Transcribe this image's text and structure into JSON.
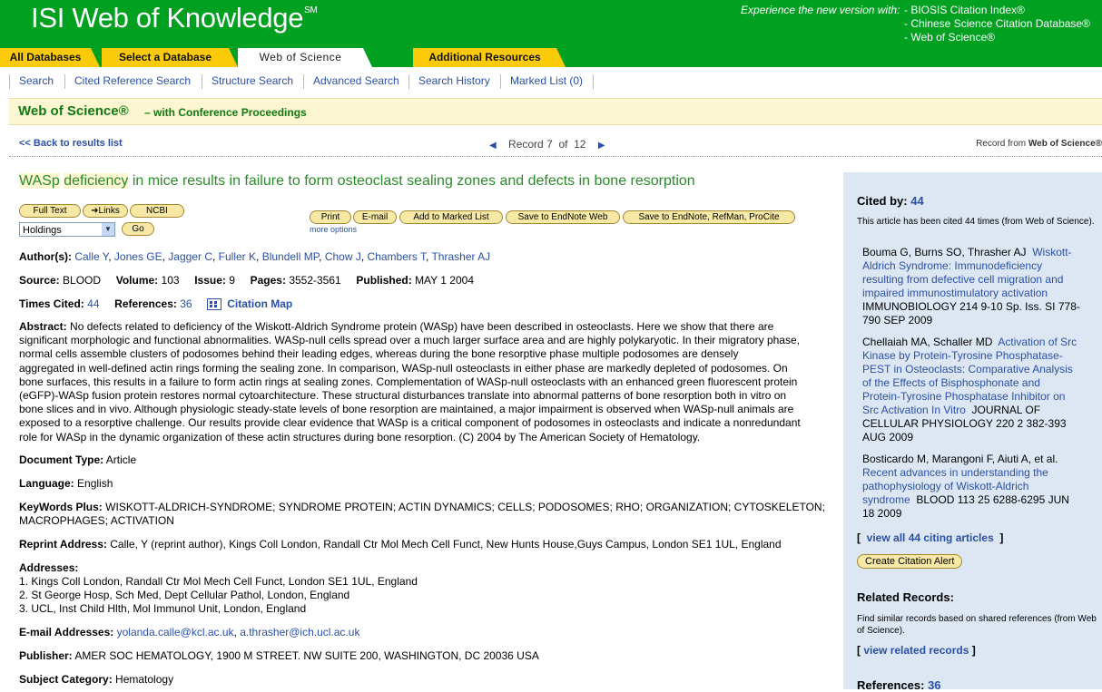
{
  "header": {
    "brand": "ISI Web of Knowledge",
    "brand_mark": "SM",
    "experience_label": "Experience the new version with:",
    "experience_links": [
      "- BIOSIS Citation Index®",
      "- Chinese Science Citation Database®",
      "- Web of Science®"
    ]
  },
  "tabs": [
    "All Databases",
    "Select a Database",
    "Web of Science",
    "Additional Resources"
  ],
  "subnav": [
    "Search",
    "Cited Reference Search",
    "Structure Search",
    "Advanced Search",
    "Search History",
    "Marked List (0)"
  ],
  "wos_bar": {
    "title": "Web of Science®",
    "subtitle": "– with Conference Proceedings"
  },
  "record_nav": {
    "back": "<< Back to results list",
    "record_label": "Record",
    "current": "7",
    "of_label": "of",
    "total": "12",
    "record_from": "Record from",
    "record_from_db": "Web of Science®"
  },
  "article": {
    "title_hl1": "WASp",
    "title_hl2": "deficiency",
    "title_rest": "in mice results in failure to form osteoclast sealing zones and defects in bone resorption",
    "buttons": {
      "fulltext": "Full Text",
      "links": "Links",
      "ncbi": "NCBI",
      "go": "Go",
      "print": "Print",
      "email": "E-mail",
      "marked": "Add to Marked List",
      "endnoteweb": "Save to EndNote Web",
      "endnote": "Save to EndNote, RefMan, ProCite",
      "more": "more options"
    },
    "holdings": "Holdings",
    "authors_label": "Author(s):",
    "authors": [
      "Calle Y",
      "Jones GE",
      "Jagger C",
      "Fuller K",
      "Blundell MP",
      "Chow J",
      "Chambers T",
      "Thrasher AJ"
    ],
    "source_label": "Source:",
    "source": "BLOOD",
    "volume_label": "Volume:",
    "volume": "103",
    "issue_label": "Issue:",
    "issue": "9",
    "pages_label": "Pages:",
    "pages": "3552-3561",
    "published_label": "Published:",
    "published": "MAY 1 2004",
    "times_cited_label": "Times Cited:",
    "times_cited": "44",
    "references_label": "References:",
    "references": "36",
    "citation_map": "Citation Map",
    "abstract_label": "Abstract:",
    "abstract_lines": [
      "No defects related to deficiency of the Wiskott-Aldrich Syndrome protein (WASp) have been described in osteoclasts. Here we show that there are",
      "significant morphologic and functional abnormalities. WASp-null cells spread over a much larger surface area and are highly polykaryotic. In their migratory phase,",
      "normal cells assemble clusters of podosomes behind their leading edges, whereas during the bone resorptive phase multiple podosomes are densely",
      "aggregated in well-defined actin rings forming the sealing zone. In comparison, WASp-null osteoclasts in either phase are markedly depleted of podosomes. On",
      "bone surfaces, this results in a failure to form actin rings at sealing zones. Complementation of WASp-null osteoclasts with an enhanced green fluorescent protein",
      "(eGFP)-WASp fusion protein restores normal cytoarchitecture. These structural disturbances translate into abnormal patterns of bone resorption both in vitro on",
      "bone slices and in vivo. Although physiologic steady-state levels of bone resorption are maintained, a major impairment is observed when WASp-null animals are",
      "exposed to a resorptive challenge. Our results provide clear evidence that WASp is a critical component of podosomes in osteoclasts and indicate a nonredundant",
      "role for WASp in the dynamic organization of these actin structures during bone resorption. (C) 2004 by The American Society of Hematology."
    ],
    "doctype_label": "Document Type:",
    "doctype": "Article",
    "language_label": "Language:",
    "language": "English",
    "keywords_label": "KeyWords Plus:",
    "keywords_line1": "WISKOTT-ALDRICH-SYNDROME; SYNDROME PROTEIN; ACTIN DYNAMICS; CELLS; PODOSOMES; RHO; ORGANIZATION; CYTOSKELETON;",
    "keywords_line2": "MACROPHAGES; ACTIVATION",
    "reprint_label": "Reprint Address:",
    "reprint": "Calle, Y (reprint author), Kings Coll London, Randall Ctr Mol Mech Cell Funct, New Hunts House,Guys Campus, London SE1 1UL, England",
    "addresses_label": "Addresses:",
    "addresses": [
      "1. Kings Coll London, Randall Ctr Mol Mech Cell Funct, London SE1 1UL, England",
      "2. St George Hosp, Sch Med, Dept Cellular Pathol, London, England",
      "3. UCL, Inst Child Hlth, Mol Immunol Unit, London, England"
    ],
    "email_label": "E-mail Addresses:",
    "emails": [
      "yolanda.calle@kcl.ac.uk",
      "a.thrasher@ich.ucl.ac.uk"
    ],
    "publisher_label": "Publisher:",
    "publisher": "AMER SOC HEMATOLOGY, 1900 M STREET. NW SUITE 200, WASHINGTON, DC 20036 USA",
    "subject_label": "Subject Category:",
    "subject": "Hematology"
  },
  "sidebar": {
    "cited_by_label": "Cited by:",
    "cited_by_count": "44",
    "cited_note": "This article has been cited 44 times (from Web of Science).",
    "citations": [
      {
        "authors": "Bouma G, Burns SO, Thrasher AJ",
        "title": "Wiskott-Aldrich Syndrome: Immunodeficiency resulting from defective cell migration and impaired immunostimulatory activation",
        "source": "IMMUNOBIOLOGY 214 9-10 Sp. Iss. SI 778-790 SEP 2009"
      },
      {
        "authors": "Chellaiah MA, Schaller MD",
        "title": "Activation of Src Kinase by Protein-Tyrosine Phosphatase-PEST in Osteoclasts: Comparative Analysis of the Effects of Bisphosphonate and Protein-Tyrosine Phosphatase Inhibitor on Src Activation In Vitro",
        "source": "JOURNAL OF CELLULAR PHYSIOLOGY 220 2 382-393 AUG 2009"
      },
      {
        "authors": "Bosticardo M, Marangoni F, Aiuti A, et al.",
        "title": "Recent advances in understanding the pathophysiology of Wiskott-Aldrich syndrome",
        "source": "BLOOD 113 25 6288-6295 JUN 18 2009"
      }
    ],
    "view_all": "view all 44 citing articles",
    "alert_button": "Create Citation Alert",
    "related_label": "Related Records:",
    "related_note": "Find similar records based on shared references (from Web of Science).",
    "view_related": "view related records",
    "references_label": "References:",
    "references_count": "36"
  }
}
